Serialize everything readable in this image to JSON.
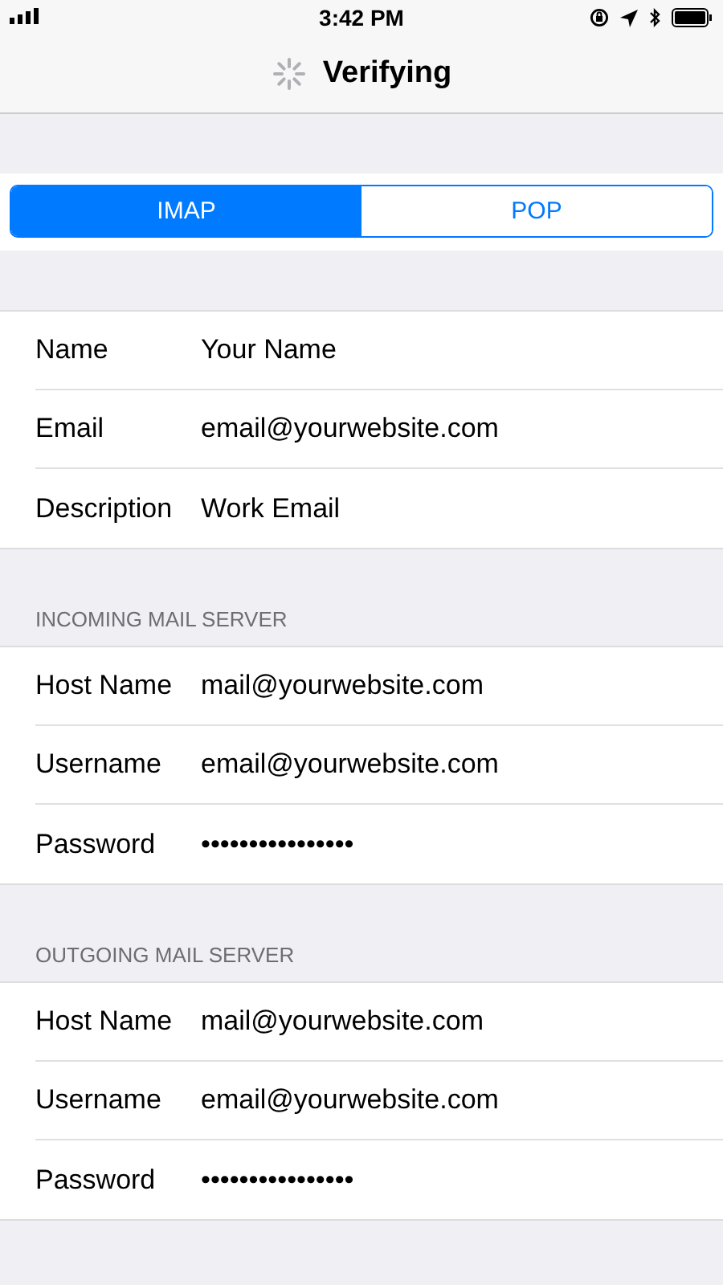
{
  "status_bar": {
    "time": "3:42 PM"
  },
  "nav": {
    "title": "Verifying"
  },
  "segments": [
    {
      "label": "IMAP",
      "selected": true
    },
    {
      "label": "POP",
      "selected": false
    }
  ],
  "sections": [
    {
      "rows": [
        {
          "label": "Name",
          "value": "Your Name"
        },
        {
          "label": "Email",
          "value": "email@yourwebsite.com"
        },
        {
          "label": "Description",
          "value": "Work Email"
        }
      ]
    },
    {
      "header": "INCOMING MAIL SERVER",
      "rows": [
        {
          "label": "Host Name",
          "value": "mail@yourwebsite.com"
        },
        {
          "label": "Username",
          "value": "email@yourwebsite.com"
        },
        {
          "label": "Password",
          "value": "••••••••••••••••"
        }
      ]
    },
    {
      "header": "OUTGOING MAIL SERVER",
      "rows": [
        {
          "label": "Host Name",
          "value": "mail@yourwebsite.com"
        },
        {
          "label": "Username",
          "value": "email@yourwebsite.com"
        },
        {
          "label": "Password",
          "value": "••••••••••••••••"
        }
      ]
    }
  ]
}
